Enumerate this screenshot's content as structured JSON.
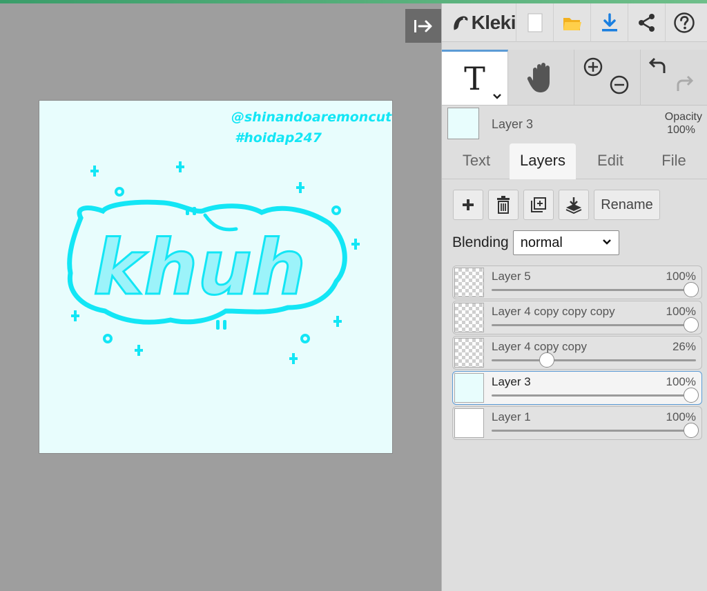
{
  "app": {
    "name": "Kleki",
    "colors": {
      "accent": "#5b9bd5",
      "download": "#1a7fe0",
      "folder": "#f2b01e",
      "art_cyan": "#13e6f5",
      "canvas_bg": "#e8fdfd"
    }
  },
  "header": {
    "logo_text": "Kleki",
    "buttons": [
      {
        "name": "new-image-icon"
      },
      {
        "name": "open-folder-icon"
      },
      {
        "name": "download-icon"
      },
      {
        "name": "share-icon"
      },
      {
        "name": "help-icon"
      }
    ]
  },
  "canvas": {
    "watermark_line1": "@shinandoaremoncute",
    "watermark_line2": "#hoidap247",
    "artwork_text": "khuh"
  },
  "tools": {
    "items": [
      {
        "name": "text-tool",
        "glyph": "T",
        "active": true
      },
      {
        "name": "hand-tool",
        "active": false
      },
      {
        "name": "zoom-tool",
        "active": false
      },
      {
        "name": "undo-redo",
        "active": false
      }
    ]
  },
  "layer_info": {
    "name": "Layer 3",
    "opacity_label": "Opacity",
    "opacity_value": "100%"
  },
  "tabs": [
    {
      "label": "Text",
      "active": false
    },
    {
      "label": "Layers",
      "active": true
    },
    {
      "label": "Edit",
      "active": false
    },
    {
      "label": "File",
      "active": false
    }
  ],
  "layer_toolbar": {
    "rename_label": "Rename"
  },
  "blending": {
    "label": "Blending",
    "value": "normal"
  },
  "layers": [
    {
      "name": "Layer 5",
      "opacity": "100%",
      "opacity_value": 1.0,
      "active": false,
      "thumb": "checker"
    },
    {
      "name": "Layer 4 copy copy copy",
      "opacity": "100%",
      "opacity_value": 1.0,
      "active": false,
      "thumb": "checker"
    },
    {
      "name": "Layer 4 copy copy",
      "opacity": "26%",
      "opacity_value": 0.26,
      "active": false,
      "thumb": "checker"
    },
    {
      "name": "Layer 3",
      "opacity": "100%",
      "opacity_value": 1.0,
      "active": true,
      "thumb": "cyan"
    },
    {
      "name": "Layer 1",
      "opacity": "100%",
      "opacity_value": 1.0,
      "active": false,
      "thumb": "white"
    }
  ]
}
